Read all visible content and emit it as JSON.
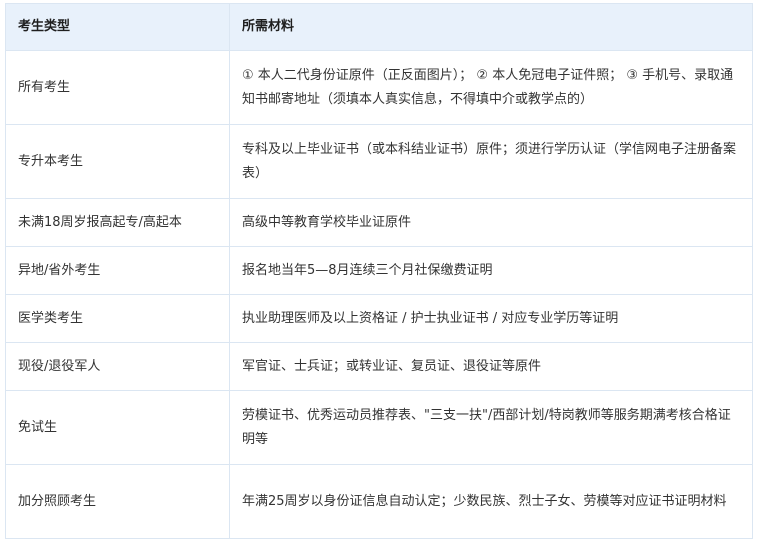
{
  "table": {
    "header": {
      "type": "考生类型",
      "materials": "所需材料"
    },
    "rows": [
      {
        "type": "所有考生",
        "materials": "① 本人二代身份证原件（正反面图片）； ② 本人免冠电子证件照； ③ 手机号、录取通知书邮寄地址（须填本人真实信息，不得填中介或教学点的）"
      },
      {
        "type": "专升本考生",
        "materials": "专科及以上毕业证书（或本科结业证书）原件；须进行学历认证（学信网电子注册备案表）"
      },
      {
        "type": "未满18周岁报高起专/高起本",
        "materials": "高级中等教育学校毕业证原件"
      },
      {
        "type": "异地/省外考生",
        "materials": "报名地当年5—8月连续三个月社保缴费证明"
      },
      {
        "type": "医学类考生",
        "materials": "执业助理医师及以上资格证 / 护士执业证书 / 对应专业学历等证明"
      },
      {
        "type": "现役/退役军人",
        "materials": "军官证、士兵证；或转业证、复员证、退役证等原件"
      },
      {
        "type": "免试生",
        "materials": "劳模证书、优秀运动员推荐表、\"三支一扶\"/西部计划/特岗教师等服务期满考核合格证明等"
      },
      {
        "type": "加分照顾考生",
        "materials": "年满25周岁以身份证信息自动认定；少数民族、烈士子女、劳模等对应证书证明材料"
      }
    ]
  }
}
